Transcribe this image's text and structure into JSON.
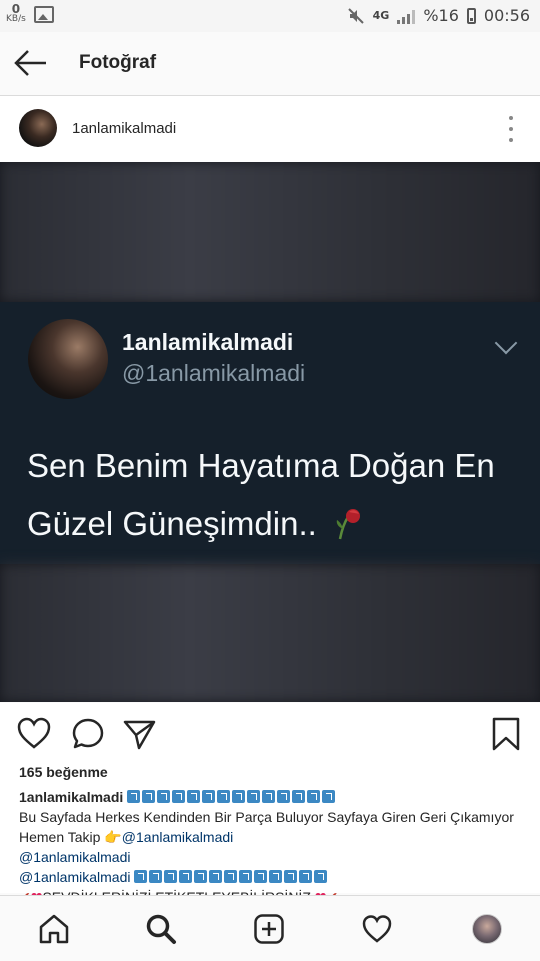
{
  "status_bar": {
    "data_rate_value": "0",
    "data_rate_unit": "KB/s",
    "network": "4G",
    "battery": "%16",
    "time": "00:56"
  },
  "header": {
    "title": "Fotoğraf"
  },
  "post": {
    "username": "1anlamikalmadi",
    "tweet": {
      "display_name": "1anlamikalmadi",
      "handle": "@1anlamikalmadi",
      "text": "Sen Benim Hayatıma Doğan En Güzel Güneşimdin.."
    },
    "likes": "165 beğenme",
    "caption": {
      "username": "1anlamikalmadi",
      "line1": "Bu Sayfada Herkes Kendinden Bir Parça Buluyor Sayfaya Giren Geri Çıkamıyor Hemen Takip 👉",
      "mention1": "@1anlamikalmadi",
      "mention2": "@1anlamikalmadi",
      "mention3": "@1anlamikalmadi",
      "last_line": "SEVDİKLERİNİZİ ETİKETLEYEBİLİRSİNİZ"
    }
  },
  "icons": {
    "back": "arrow-left-icon",
    "more": "more-vertical-icon",
    "like": "heart-icon",
    "comment": "comment-icon",
    "share": "send-icon",
    "save": "bookmark-icon",
    "home": "home-icon",
    "search": "search-icon",
    "add": "add-post-icon",
    "activity": "heart-icon",
    "profile": "avatar"
  },
  "colors": {
    "tweet_bg": "#15202b",
    "tweet_text": "#f5f8fa",
    "tweet_handle": "#8899a6",
    "mention": "#003569"
  }
}
